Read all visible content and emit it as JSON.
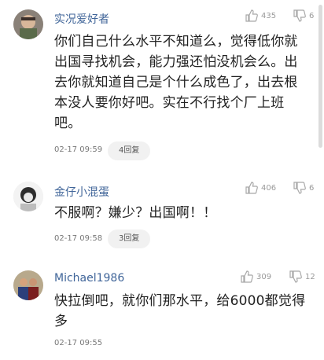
{
  "comments": [
    {
      "username": "实况爱好者",
      "likes": "435",
      "dislikes": "6",
      "lines": [
        "你们自己什么水平不知道么，觉得低你就",
        "出国寻找机会，能力强还怕没机会么。出",
        "去你就知道自己是个什么成色了，出去根",
        "本没人要你好吧。实在不行找个厂上班",
        "吧。"
      ],
      "time": "02-17 09:59",
      "reply": "4回复"
    },
    {
      "username": "金仔小混蛋",
      "likes": "406",
      "dislikes": "6",
      "lines": [
        "不服啊？嫌少？出国啊！！"
      ],
      "time": "02-17 09:58",
      "reply": "3回复"
    },
    {
      "username": "Michael1986",
      "likes": "309",
      "dislikes": "12",
      "lines": [
        "快拉倒吧，就你们那水平，给6000都觉得",
        "多"
      ],
      "time": "02-17 09:55"
    }
  ],
  "icons": {
    "like": "thumbs-up-icon",
    "dislike": "thumbs-down-icon"
  },
  "colors": {
    "username": "#406599",
    "text": "#222222",
    "meta": "#777777"
  }
}
